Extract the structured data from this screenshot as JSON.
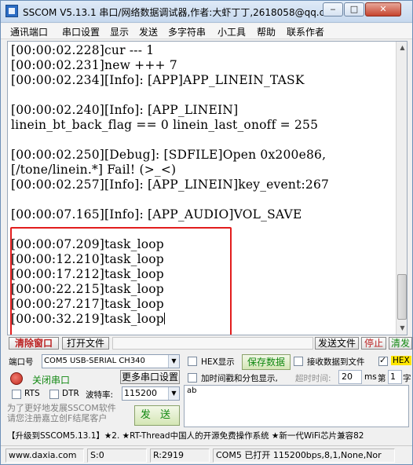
{
  "window": {
    "title": "SSCOM V5.13.1 串口/网络数据调试器,作者:大虾丁丁,2618058@qq.c..."
  },
  "window_controls": {
    "minimize": "‒",
    "maximize": "□",
    "close": "✕"
  },
  "menu": {
    "items": [
      "通讯端口",
      "串口设置",
      "显示",
      "发送",
      "多字符串",
      "小工具",
      "帮助",
      "联系作者"
    ]
  },
  "terminal": {
    "lines": [
      "[00:00:02.228]cur --- 1",
      "[00:00:02.231]new +++ 7",
      "[00:00:02.234][Info]: [APP]APP_LINEIN_TASK",
      "",
      "[00:00:02.240][Info]: [APP_LINEIN]",
      "linein_bt_back_flag == 0 linein_last_onoff = 255",
      "",
      "[00:00:02.250][Debug]: [SDFILE]Open 0x200e86,",
      "[/tone/linein.*] Fail! (>_<)",
      "[00:00:02.257][Info]: [APP_LINEIN]key_event:267",
      "",
      "[00:00:07.165][Info]: [APP_AUDIO]VOL_SAVE",
      "",
      "[00:00:07.209]task_loop",
      "[00:00:12.210]task_loop",
      "[00:00:17.212]task_loop",
      "[00:00:22.215]task_loop",
      "[00:00:27.217]task_loop",
      "[00:00:32.219]task_loop"
    ]
  },
  "toolbar": {
    "clear_window": "清除窗口",
    "open_file": "打开文件",
    "send_file": "发送文件",
    "stop": "停止",
    "clear_send": "清发"
  },
  "port": {
    "label": "端口号",
    "value": "COM5 USB-SERIAL CH340",
    "close_port": "关闭串口",
    "more_settings": "更多串口设置",
    "rts_label": "RTS",
    "dtr_label": "DTR",
    "baud_label": "波特率:",
    "baud_value": "115200"
  },
  "options": {
    "hex_display": "HEX显示",
    "save_data": "保存数据",
    "recv_to_file": "接收数据到文件",
    "hex_send": "HEX",
    "timestamp": "加时间戳和分包显示,",
    "timeout_label": "超时时间:",
    "timeout_value": "20",
    "timeout_unit": "ms",
    "page_label": "第",
    "page_value": "1",
    "page_unit": "字"
  },
  "send": {
    "input_value": "ab",
    "send_button": "发 送",
    "promo_line1": "为了更好地发展SSCOM软件",
    "promo_line2": "请您注册嘉立创F结尾客户"
  },
  "ticker": {
    "text": "【升级到SSCOM5.13.1】★2. ★RT-Thread中国人的开源免费操作系统 ★新一代WiFi芯片兼容82"
  },
  "statusbar": {
    "website": "www.daxia.com",
    "sent": "S:0",
    "received": "R:2919",
    "port_status": "COM5 已打开  115200bps,8,1,None,Nor"
  },
  "colors": {
    "highlight_box": "#e21d1d",
    "close_port_icon": "#d82b1f",
    "action_text": "#118811"
  }
}
